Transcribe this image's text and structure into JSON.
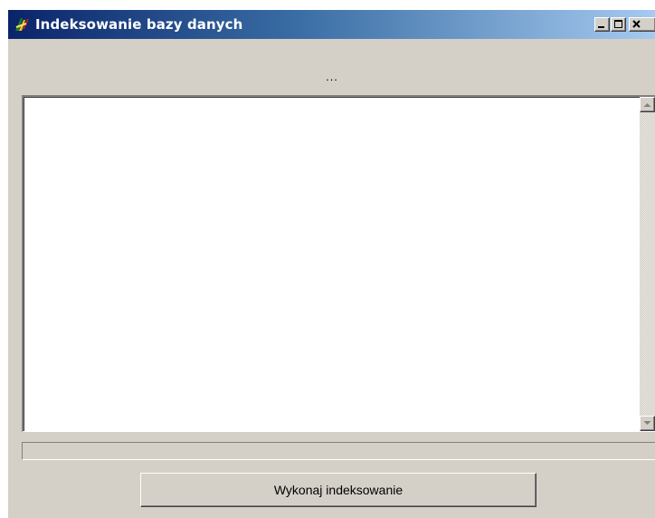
{
  "window": {
    "title": "Indeksowanie bazy danych",
    "icon": "app-icon",
    "controls": {
      "minimize": "minimize-icon",
      "maximize": "maximize-icon",
      "close": "close-icon"
    }
  },
  "status": {
    "text": "..."
  },
  "log": {
    "text": ""
  },
  "progress": {
    "value_percent": 0
  },
  "actions": {
    "run_label": "Wykonaj indeksowanie"
  },
  "colors": {
    "window_bg": "#d4d0c8",
    "titlebar_start": "#0a246a",
    "titlebar_end": "#a6caf0",
    "log_bg": "#ffffff"
  }
}
